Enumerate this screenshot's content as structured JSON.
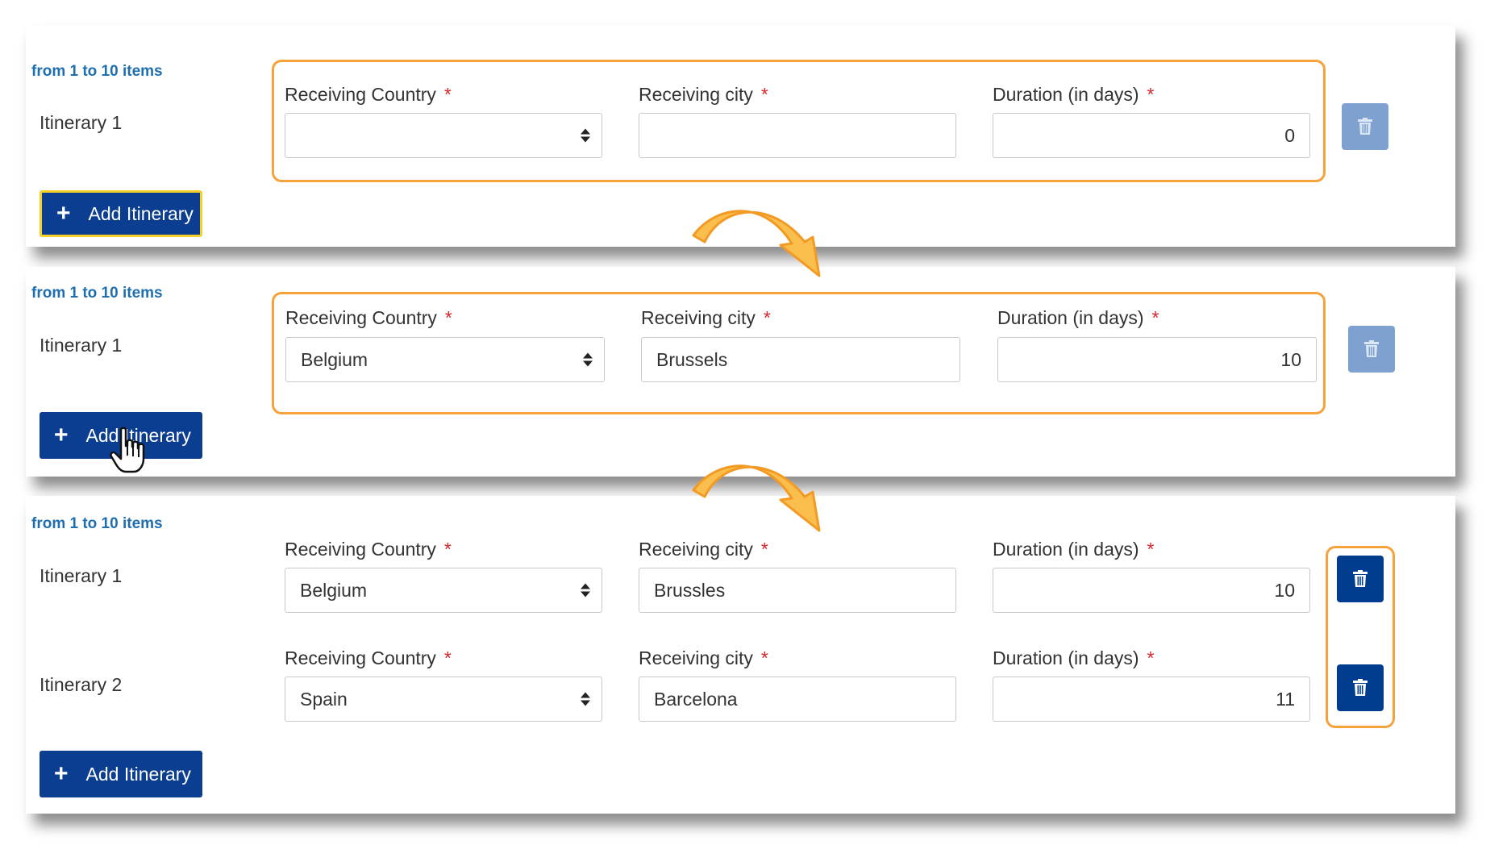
{
  "count_text": "from 1 to 10 items",
  "labels": {
    "country": "Receiving Country",
    "city": "Receiving city",
    "duration": "Duration (in days)",
    "required_mark": "*"
  },
  "add_button_label": "Add Itinerary",
  "itinerary_1": "Itinerary 1",
  "itinerary_2": "Itinerary 2",
  "step1": {
    "country": "",
    "city": "",
    "duration": "0"
  },
  "step2": {
    "country": "Belgium",
    "city": "Brussels",
    "duration": "10"
  },
  "step3": {
    "rows": [
      {
        "country": "Belgium",
        "city": "Brussles",
        "duration": "10"
      },
      {
        "country": "Spain",
        "city": "Barcelona",
        "duration": "11"
      }
    ]
  },
  "icons": {
    "add": "plus-icon",
    "delete": "trash-icon",
    "select": "sort-caret-icon",
    "transition": "curved-arrow-icon",
    "cursor": "hand-pointer-icon"
  },
  "colors": {
    "highlight": "#f5a23a",
    "primary_button": "#0b3e91",
    "disabled_delete": "#7ea1d0",
    "link": "#1f6fb0",
    "required": "#d9262b"
  }
}
